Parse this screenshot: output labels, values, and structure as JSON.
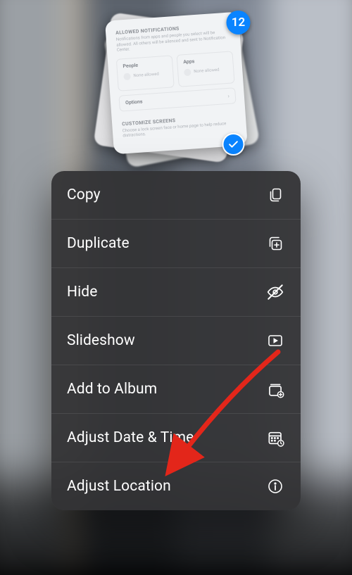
{
  "selection": {
    "count": "12",
    "checked": true
  },
  "preview_card": {
    "section1_title": "ALLOWED NOTIFICATIONS",
    "section1_sub": "Notifications from apps and people you select will be allowed. All others will be silenced and sent to Notification Center.",
    "cell_people": "People",
    "cell_apps": "Apps",
    "cell_none": "None allowed",
    "options": "Options",
    "section2_title": "CUSTOMIZE SCREENS",
    "section2_sub": "Choose a lock screen face or home page to help reduce distractions."
  },
  "menu": {
    "copy": "Copy",
    "duplicate": "Duplicate",
    "hide": "Hide",
    "slideshow": "Slideshow",
    "add_to_album": "Add to Album",
    "adjust_date_time": "Adjust Date & Time",
    "adjust_location": "Adjust Location"
  },
  "annotation": {
    "arrow_color": "#e3261a"
  }
}
